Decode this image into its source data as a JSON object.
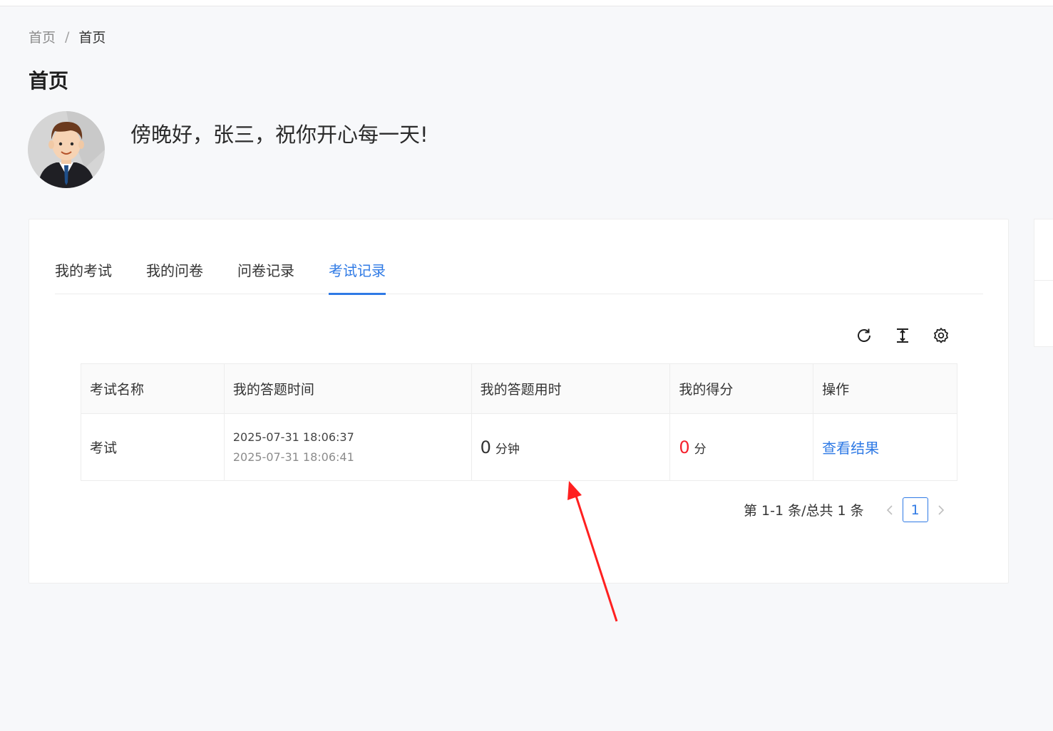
{
  "breadcrumb": {
    "home": "首页",
    "separator": "/",
    "current": "首页"
  },
  "page": {
    "title": "首页"
  },
  "welcome": {
    "greeting": "傍晚好，张三，祝你开心每一天!"
  },
  "tabs": [
    {
      "label": "我的考试",
      "active": false
    },
    {
      "label": "我的问卷",
      "active": false
    },
    {
      "label": "问卷记录",
      "active": false
    },
    {
      "label": "考试记录",
      "active": true
    }
  ],
  "toolbar": {
    "icons": [
      "refresh-icon",
      "column-height-icon",
      "settings-icon"
    ]
  },
  "table": {
    "columns": [
      "考试名称",
      "我的答题时间",
      "我的答题用时",
      "我的得分",
      "操作"
    ],
    "rows": [
      {
        "name": "考试",
        "start_time": "2025-07-31 18:06:37",
        "end_time": "2025-07-31 18:06:41",
        "duration": "0",
        "duration_unit": "分钟",
        "score": "0",
        "score_unit": "分",
        "action": "查看结果"
      }
    ]
  },
  "pagination": {
    "summary": "第 1-1 条/总共 1 条",
    "current_page": "1"
  },
  "colors": {
    "accent": "#2f7ae5",
    "score": "#f5222d",
    "annotation_arrow": "#ff2020"
  }
}
